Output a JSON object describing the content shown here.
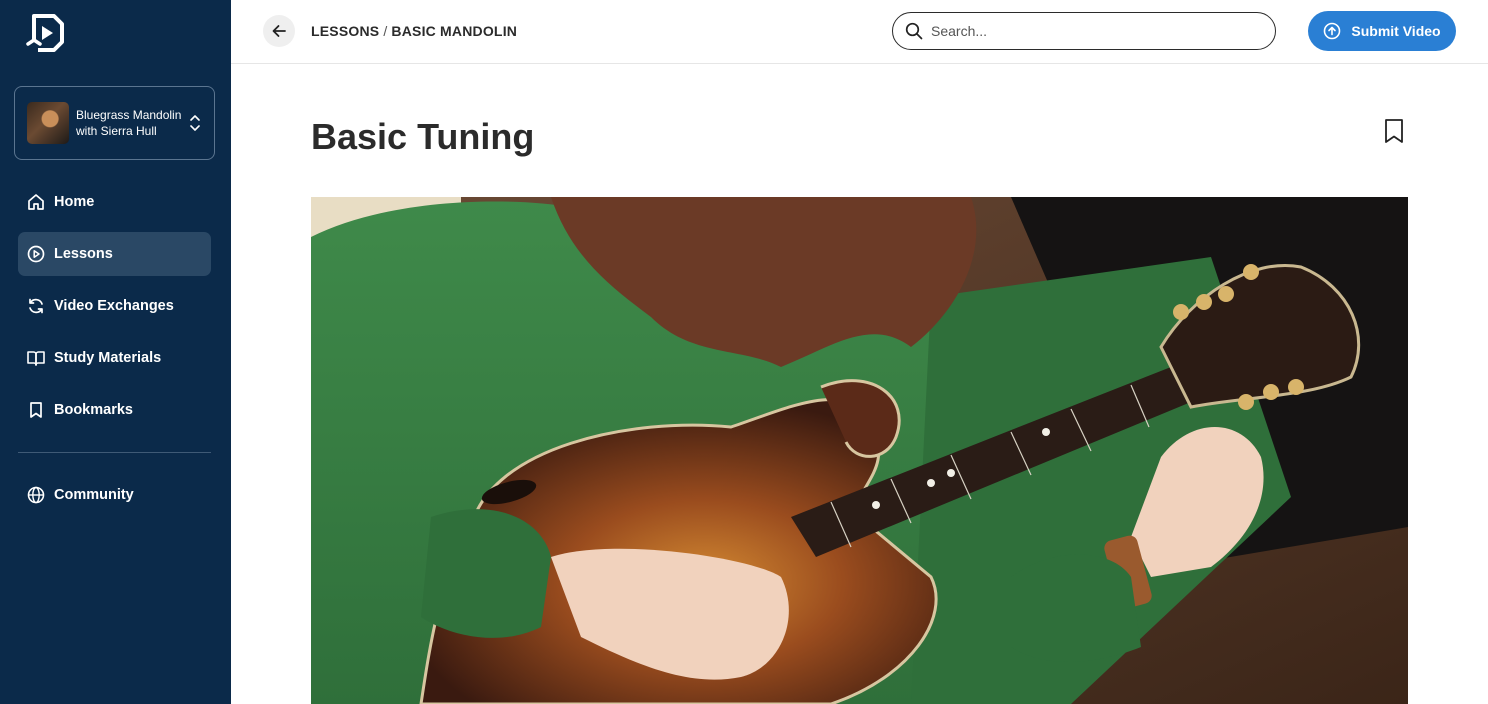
{
  "sidebar": {
    "course": {
      "title": "Bluegrass Mandolin with Sierra Hull"
    },
    "nav": [
      {
        "label": "Home",
        "icon": "home-icon"
      },
      {
        "label": "Lessons",
        "icon": "play-circle-icon",
        "active": true
      },
      {
        "label": "Video Exchanges",
        "icon": "refresh-icon"
      },
      {
        "label": "Study Materials",
        "icon": "book-icon"
      },
      {
        "label": "Bookmarks",
        "icon": "bookmark-icon"
      }
    ],
    "community": {
      "label": "Community",
      "icon": "globe-icon"
    }
  },
  "header": {
    "breadcrumb": [
      "LESSONS",
      "BASIC MANDOLIN"
    ],
    "breadcrumb_separator": "/",
    "search_placeholder": "Search...",
    "submit_label": "Submit Video"
  },
  "main": {
    "title": "Basic Tuning"
  },
  "colors": {
    "sidebar_bg": "#0b2a4a",
    "nav_active_bg": "#2a4865",
    "accent": "#2a7fd4"
  }
}
